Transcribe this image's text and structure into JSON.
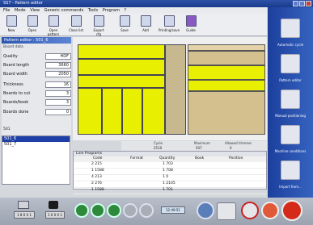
{
  "window": {
    "title": "SS7 - Pattern editor"
  },
  "menu": [
    "File",
    "Mode",
    "View",
    "Generic commands",
    "Tools",
    "Program",
    "?"
  ],
  "toolbar": [
    "New",
    "Open",
    "Open pattern",
    "Close list",
    "Export cfg",
    "Save",
    "Add",
    "Printing/save",
    "Guide"
  ],
  "editor": {
    "title": "Pattern editor : 501_6",
    "board_data_label": "Board data",
    "fields": [
      {
        "label": "Quality",
        "value": "HDF"
      },
      {
        "label": "Board length",
        "value": "3660"
      },
      {
        "label": "Board width",
        "value": "2050"
      },
      {
        "label": "Thickness",
        "value": "16"
      },
      {
        "label": "Boards to cut",
        "value": "3"
      },
      {
        "label": "Boards/book",
        "value": "3"
      },
      {
        "label": "Boards done",
        "value": "0"
      }
    ]
  },
  "pattern_list": {
    "header": "501",
    "items": [
      "501_6",
      "501_7"
    ]
  },
  "summary": {
    "headers": [
      "Cycle",
      "Maximum",
      "Allowed trimmer"
    ],
    "values": [
      "2510",
      "507",
      "0"
    ]
  },
  "line_programs": {
    "title": "Line Programs",
    "columns": [
      "Code",
      "Format",
      "Quantity",
      "Book",
      "Position"
    ],
    "rows": [
      [
        "2 215",
        "",
        "1 703",
        "",
        ""
      ],
      [
        "1 1588",
        "",
        "1 708",
        "",
        ""
      ],
      [
        "4 213",
        "",
        "1 0",
        "",
        ""
      ],
      [
        "2 276",
        "",
        "1 2105",
        "",
        ""
      ],
      [
        "1 1588",
        "",
        "1 701",
        "",
        ""
      ]
    ]
  },
  "right_panel": [
    "Automatic cycle",
    "Pattern editor",
    "Manual positioning",
    "Machine conditions",
    "Import from..."
  ],
  "bottom": {
    "counter1": "1 8 6 0 1",
    "counter2": "1 6 0 0 1",
    "clock": "12:49:51"
  }
}
